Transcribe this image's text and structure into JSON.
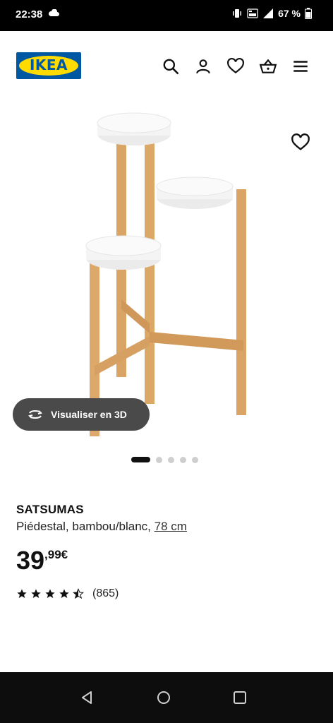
{
  "status_bar": {
    "time": "22:38",
    "battery": "67 %",
    "icons": [
      "cloud-icon",
      "vibrate-icon",
      "volte-icon",
      "signal-4g-icon",
      "battery-icon"
    ]
  },
  "header": {
    "logo_text": "IKEA",
    "icons": [
      "search-icon",
      "account-icon",
      "heart-icon",
      "basket-icon",
      "menu-icon"
    ]
  },
  "gallery": {
    "view_3d_label": "Visualiser en 3D",
    "dots": 5,
    "active_dot": 1
  },
  "product": {
    "name": "SATSUMAS",
    "description": "Piédestal, bambou/blanc,",
    "size": "78 cm",
    "price_int": "39",
    "price_dec": ",99€",
    "rating_stars": 4.5,
    "rating_count": "(865)"
  },
  "colors": {
    "ikea_blue": "#0058a3",
    "ikea_yellow": "#ffdb00",
    "bamboo": "#d9a465",
    "tray_white": "#f4f4f4"
  },
  "nav_bar": {
    "icons": [
      "back-icon",
      "home-icon",
      "recents-icon"
    ]
  }
}
